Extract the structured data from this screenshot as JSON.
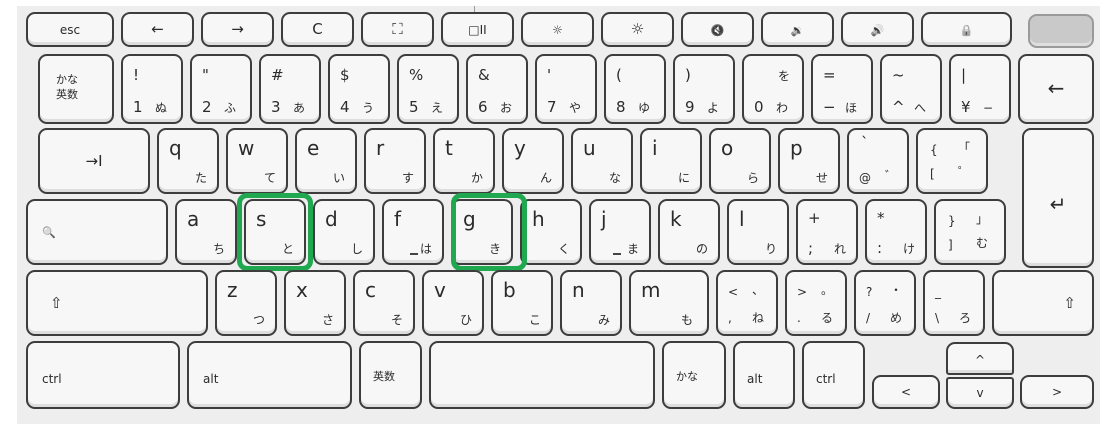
{
  "keyboard": {
    "row_fn": {
      "esc": "esc",
      "back": "←",
      "forward": "→",
      "reload": "C",
      "fullscreen": "⛶",
      "overview": "□II",
      "bright_down": "☼",
      "bright_up": "☼",
      "mute": "🔇",
      "vol_down": "🔉",
      "vol_up": "🔊",
      "lock": "🔒"
    },
    "row_num": {
      "kana_toggle_1": "かな",
      "kana_toggle_2": "英数",
      "k1": {
        "top": "!",
        "bottom": "1",
        "kana": "ぬ"
      },
      "k2": {
        "top": "\"",
        "bottom": "2",
        "kana": "ふ"
      },
      "k3": {
        "top": "#",
        "bottom": "3",
        "kana": "あ"
      },
      "k4": {
        "top": "$",
        "bottom": "4",
        "kana": "う"
      },
      "k5": {
        "top": "%",
        "bottom": "5",
        "kana": "え"
      },
      "k6": {
        "top": "&",
        "bottom": "6",
        "kana": "お"
      },
      "k7": {
        "top": "'",
        "bottom": "7",
        "kana": "や"
      },
      "k8": {
        "top": "(",
        "bottom": "8",
        "kana": "ゆ"
      },
      "k9": {
        "top": ")",
        "bottom": "9",
        "kana": "よ"
      },
      "k0": {
        "top": "を",
        "bottom": "0",
        "kana": "わ"
      },
      "kminus": {
        "top": "=",
        "bottom": "−",
        "kana": "ほ"
      },
      "kcaret": {
        "top": "~",
        "bottom": "^",
        "kana": "へ"
      },
      "kyen": {
        "top": "|",
        "bottom": "¥",
        "kana": "−"
      },
      "backspace": "←"
    },
    "row_q": {
      "tab": "→I",
      "q": {
        "letter": "q",
        "kana": "た"
      },
      "w": {
        "letter": "w",
        "kana": "て"
      },
      "e": {
        "letter": "e",
        "kana": "い"
      },
      "r": {
        "letter": "r",
        "kana": "す"
      },
      "t": {
        "letter": "t",
        "kana": "か"
      },
      "y": {
        "letter": "y",
        "kana": "ん"
      },
      "u": {
        "letter": "u",
        "kana": "な"
      },
      "i": {
        "letter": "i",
        "kana": "に"
      },
      "o": {
        "letter": "o",
        "kana": "ら"
      },
      "p": {
        "letter": "p",
        "kana": "せ"
      },
      "at": {
        "top": "`",
        "bottom": "@",
        "kana": "゛"
      },
      "bracket": {
        "top": "{",
        "top_kana": "「",
        "bottom": "[",
        "kana": "゜"
      },
      "enter": "↵"
    },
    "row_a": {
      "search": "🔍",
      "a": {
        "letter": "a",
        "kana": "ち"
      },
      "s": {
        "letter": "s",
        "kana": "と"
      },
      "d": {
        "letter": "d",
        "kana": "し"
      },
      "f": {
        "letter": "f",
        "kana": "は"
      },
      "g": {
        "letter": "g",
        "kana": "き"
      },
      "h": {
        "letter": "h",
        "kana": "く"
      },
      "j": {
        "letter": "j",
        "kana": "ま"
      },
      "k": {
        "letter": "k",
        "kana": "の"
      },
      "l": {
        "letter": "l",
        "kana": "り"
      },
      "semi": {
        "top": "+",
        "bottom": ";",
        "kana": "れ"
      },
      "colon": {
        "top": "*",
        "bottom": ":",
        "kana": "け"
      },
      "rbracket": {
        "top": "}",
        "top_kana": "」",
        "bottom": "]",
        "kana": "む"
      }
    },
    "row_z": {
      "shift_left": "⇧",
      "z": {
        "letter": "z",
        "kana": "つ"
      },
      "x": {
        "letter": "x",
        "kana": "さ"
      },
      "c": {
        "letter": "c",
        "kana": "そ"
      },
      "v": {
        "letter": "v",
        "kana": "ひ"
      },
      "b": {
        "letter": "b",
        "kana": "こ"
      },
      "n": {
        "letter": "n",
        "kana": "み"
      },
      "m": {
        "letter": "m",
        "kana": "も"
      },
      "comma": {
        "top": "<",
        "top_kana": "、",
        "bottom": ",",
        "kana": "ね"
      },
      "period": {
        "top": ">",
        "top_kana": "。",
        "bottom": ".",
        "kana": "る"
      },
      "slash": {
        "top": "?",
        "top_kana": "・",
        "bottom": "/",
        "kana": "め"
      },
      "backslash": {
        "top": "_",
        "bottom": "\\",
        "kana": "ろ"
      },
      "shift_right": "⇧"
    },
    "row_bottom": {
      "ctrl_left": "ctrl",
      "alt_left": "alt",
      "eisu": "英数",
      "kana": "かな",
      "alt_right": "alt",
      "ctrl_right": "ctrl",
      "arrow_left": "<",
      "arrow_up": "^",
      "arrow_down": "v",
      "arrow_right": ">"
    }
  },
  "highlight_color": "#1fa84f"
}
